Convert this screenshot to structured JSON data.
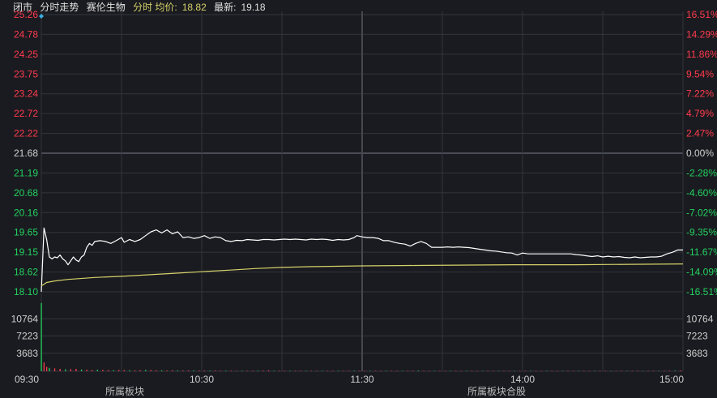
{
  "header": {
    "status": "闭市",
    "mode": "分时走势",
    "stock_name": "赛伦生物",
    "avg_label": "分时 均价:",
    "avg_value": "18.82",
    "latest_label": "最新:",
    "latest_value": "19.18"
  },
  "bottom_fragments": [
    "所属板块",
    "所属板块合股"
  ],
  "colors": {
    "background": "#1a1b20",
    "grid": "#33353b",
    "price_line": "#ffffff",
    "avg_line": "#d6d26a",
    "up": "#ff3b4e",
    "down": "#23d160",
    "neutral": "#d0d0d0",
    "marker": "#3ab0e0"
  },
  "chart_data": {
    "type": "line",
    "prev_close": 21.68,
    "price_axis": {
      "ticks": [
        "25.26",
        "24.78",
        "24.25",
        "23.75",
        "23.24",
        "22.72",
        "22.22",
        "21.68",
        "21.19",
        "20.68",
        "20.16",
        "19.65",
        "19.15",
        "18.62",
        "18.10"
      ],
      "ylim": [
        18.1,
        25.26
      ]
    },
    "pct_axis": {
      "ticks": [
        "16.51%",
        "14.29%",
        "11.86%",
        "9.54%",
        "7.22%",
        "4.79%",
        "2.47%",
        "0.00%",
        "-2.28%",
        "-4.60%",
        "-7.02%",
        "-9.35%",
        "-11.67%",
        "-14.09%",
        "-16.51%"
      ]
    },
    "volume_axis": {
      "ticks": [
        "10764",
        "7223",
        "3683"
      ],
      "ylim": [
        0,
        14300
      ]
    },
    "time_axis": {
      "labels": [
        "09:30",
        "10:30",
        "11:30",
        "14:00",
        "15:00"
      ],
      "minutes_total": 240
    },
    "series": [
      {
        "key": "price",
        "points": [
          [
            0,
            18.1
          ],
          [
            1,
            19.75
          ],
          [
            2,
            19.45
          ],
          [
            3,
            19.0
          ],
          [
            4,
            18.95
          ],
          [
            5,
            19.0
          ],
          [
            6,
            18.98
          ],
          [
            7,
            19.05
          ],
          [
            8,
            18.95
          ],
          [
            9,
            18.9
          ],
          [
            10,
            18.8
          ],
          [
            11,
            18.9
          ],
          [
            12,
            19.0
          ],
          [
            13,
            18.92
          ],
          [
            14,
            18.88
          ],
          [
            15,
            19.0
          ],
          [
            16,
            19.05
          ],
          [
            17,
            19.25
          ],
          [
            18,
            19.35
          ],
          [
            19,
            19.3
          ],
          [
            20,
            19.4
          ],
          [
            22,
            19.42
          ],
          [
            24,
            19.4
          ],
          [
            26,
            19.35
          ],
          [
            28,
            19.42
          ],
          [
            30,
            19.5
          ],
          [
            31,
            19.38
          ],
          [
            33,
            19.45
          ],
          [
            35,
            19.4
          ],
          [
            37,
            19.45
          ],
          [
            39,
            19.55
          ],
          [
            41,
            19.65
          ],
          [
            43,
            19.7
          ],
          [
            45,
            19.62
          ],
          [
            47,
            19.7
          ],
          [
            49,
            19.6
          ],
          [
            51,
            19.65
          ],
          [
            53,
            19.5
          ],
          [
            55,
            19.52
          ],
          [
            57,
            19.48
          ],
          [
            59,
            19.5
          ],
          [
            61,
            19.55
          ],
          [
            63,
            19.48
          ],
          [
            65,
            19.52
          ],
          [
            67,
            19.5
          ],
          [
            69,
            19.42
          ],
          [
            71,
            19.4
          ],
          [
            73,
            19.43
          ],
          [
            75,
            19.42
          ],
          [
            77,
            19.45
          ],
          [
            79,
            19.44
          ],
          [
            81,
            19.43
          ],
          [
            83,
            19.45
          ],
          [
            85,
            19.45
          ],
          [
            87,
            19.44
          ],
          [
            89,
            19.45
          ],
          [
            91,
            19.46
          ],
          [
            93,
            19.45
          ],
          [
            95,
            19.46
          ],
          [
            97,
            19.45
          ],
          [
            99,
            19.44
          ],
          [
            101,
            19.46
          ],
          [
            103,
            19.45
          ],
          [
            105,
            19.46
          ],
          [
            107,
            19.45
          ],
          [
            109,
            19.43
          ],
          [
            111,
            19.45
          ],
          [
            113,
            19.44
          ],
          [
            115,
            19.45
          ],
          [
            117,
            19.5
          ],
          [
            118,
            19.55
          ],
          [
            120,
            19.52
          ],
          [
            122,
            19.5
          ],
          [
            124,
            19.5
          ],
          [
            126,
            19.48
          ],
          [
            128,
            19.42
          ],
          [
            130,
            19.42
          ],
          [
            132,
            19.38
          ],
          [
            134,
            19.35
          ],
          [
            136,
            19.33
          ],
          [
            138,
            19.28
          ],
          [
            140,
            19.35
          ],
          [
            142,
            19.4
          ],
          [
            144,
            19.35
          ],
          [
            146,
            19.25
          ],
          [
            148,
            19.25
          ],
          [
            150,
            19.25
          ],
          [
            152,
            19.26
          ],
          [
            154,
            19.25
          ],
          [
            156,
            19.26
          ],
          [
            158,
            19.25
          ],
          [
            160,
            19.24
          ],
          [
            162,
            19.22
          ],
          [
            164,
            19.2
          ],
          [
            166,
            19.18
          ],
          [
            168,
            19.16
          ],
          [
            170,
            19.15
          ],
          [
            172,
            19.13
          ],
          [
            174,
            19.11
          ],
          [
            176,
            19.1
          ],
          [
            178,
            19.05
          ],
          [
            180,
            19.1
          ],
          [
            182,
            19.08
          ],
          [
            184,
            19.08
          ],
          [
            186,
            19.08
          ],
          [
            188,
            19.08
          ],
          [
            190,
            19.08
          ],
          [
            192,
            19.08
          ],
          [
            194,
            19.08
          ],
          [
            196,
            19.08
          ],
          [
            198,
            19.08
          ],
          [
            200,
            19.06
          ],
          [
            202,
            19.05
          ],
          [
            204,
            19.03
          ],
          [
            206,
            19.01
          ],
          [
            208,
            19.03
          ],
          [
            210,
            19.0
          ],
          [
            212,
            19.02
          ],
          [
            214,
            19.0
          ],
          [
            216,
            19.01
          ],
          [
            218,
            18.99
          ],
          [
            220,
            18.98
          ],
          [
            222,
            19.0
          ],
          [
            224,
            18.98
          ],
          [
            226,
            18.99
          ],
          [
            228,
            19.0
          ],
          [
            230,
            19.0
          ],
          [
            232,
            19.02
          ],
          [
            234,
            19.08
          ],
          [
            236,
            19.12
          ],
          [
            238,
            19.18
          ],
          [
            240,
            19.18
          ]
        ]
      },
      {
        "key": "average",
        "points": [
          [
            0,
            18.25
          ],
          [
            2,
            18.34
          ],
          [
            5,
            18.38
          ],
          [
            10,
            18.42
          ],
          [
            20,
            18.47
          ],
          [
            30,
            18.5
          ],
          [
            40,
            18.54
          ],
          [
            50,
            18.58
          ],
          [
            60,
            18.62
          ],
          [
            70,
            18.66
          ],
          [
            80,
            18.7
          ],
          [
            90,
            18.73
          ],
          [
            100,
            18.75
          ],
          [
            110,
            18.76
          ],
          [
            120,
            18.77
          ],
          [
            140,
            18.78
          ],
          [
            160,
            18.79
          ],
          [
            180,
            18.8
          ],
          [
            200,
            18.8
          ],
          [
            220,
            18.81
          ],
          [
            240,
            18.82
          ]
        ]
      }
    ],
    "volume": [
      [
        0,
        14000
      ],
      [
        1,
        1800
      ],
      [
        2,
        900
      ],
      [
        3,
        700
      ],
      [
        5,
        600
      ],
      [
        7,
        500
      ],
      [
        9,
        400
      ],
      [
        11,
        450
      ],
      [
        13,
        500
      ],
      [
        15,
        350
      ],
      [
        17,
        300
      ],
      [
        19,
        250
      ],
      [
        21,
        300
      ],
      [
        23,
        280
      ],
      [
        25,
        220
      ],
      [
        27,
        200
      ],
      [
        29,
        250
      ],
      [
        31,
        240
      ],
      [
        33,
        200
      ],
      [
        35,
        180
      ],
      [
        37,
        220
      ],
      [
        39,
        260
      ],
      [
        41,
        240
      ],
      [
        43,
        200
      ],
      [
        45,
        180
      ],
      [
        47,
        160
      ],
      [
        49,
        180
      ],
      [
        51,
        150
      ],
      [
        53,
        140
      ],
      [
        55,
        160
      ],
      [
        57,
        150
      ],
      [
        59,
        130
      ],
      [
        61,
        140
      ],
      [
        63,
        120
      ],
      [
        65,
        130
      ],
      [
        67,
        120
      ],
      [
        69,
        110
      ],
      [
        71,
        120
      ],
      [
        73,
        100
      ],
      [
        75,
        110
      ],
      [
        77,
        100
      ],
      [
        79,
        120
      ],
      [
        81,
        110
      ],
      [
        83,
        140
      ],
      [
        85,
        180
      ],
      [
        87,
        120
      ],
      [
        89,
        110
      ],
      [
        91,
        100
      ],
      [
        93,
        110
      ],
      [
        95,
        100
      ],
      [
        97,
        110
      ],
      [
        99,
        100
      ],
      [
        101,
        90
      ],
      [
        103,
        100
      ],
      [
        105,
        95
      ],
      [
        107,
        90
      ],
      [
        109,
        100
      ],
      [
        111,
        95
      ],
      [
        113,
        90
      ],
      [
        115,
        100
      ],
      [
        117,
        120
      ],
      [
        119,
        100
      ],
      [
        121,
        110
      ],
      [
        123,
        95
      ],
      [
        125,
        100
      ],
      [
        127,
        95
      ],
      [
        129,
        90
      ],
      [
        131,
        100
      ],
      [
        133,
        95
      ],
      [
        135,
        90
      ],
      [
        137,
        100
      ],
      [
        139,
        110
      ],
      [
        141,
        120
      ],
      [
        143,
        100
      ],
      [
        145,
        95
      ],
      [
        147,
        90
      ],
      [
        149,
        85
      ],
      [
        151,
        90
      ],
      [
        153,
        85
      ],
      [
        155,
        90
      ],
      [
        157,
        85
      ],
      [
        159,
        80
      ],
      [
        161,
        90
      ],
      [
        163,
        85
      ],
      [
        165,
        80
      ],
      [
        167,
        85
      ],
      [
        169,
        90
      ],
      [
        171,
        85
      ],
      [
        173,
        80
      ],
      [
        175,
        90
      ],
      [
        177,
        85
      ],
      [
        179,
        80
      ],
      [
        181,
        85
      ],
      [
        183,
        90
      ],
      [
        185,
        85
      ],
      [
        187,
        80
      ],
      [
        189,
        85
      ],
      [
        191,
        90
      ],
      [
        193,
        80
      ],
      [
        195,
        85
      ],
      [
        197,
        90
      ],
      [
        199,
        85
      ],
      [
        201,
        80
      ],
      [
        203,
        85
      ],
      [
        205,
        80
      ],
      [
        207,
        85
      ],
      [
        209,
        80
      ],
      [
        211,
        85
      ],
      [
        213,
        80
      ],
      [
        215,
        85
      ],
      [
        217,
        80
      ],
      [
        219,
        85
      ],
      [
        221,
        90
      ],
      [
        223,
        80
      ],
      [
        225,
        85
      ],
      [
        227,
        80
      ],
      [
        229,
        90
      ],
      [
        231,
        85
      ],
      [
        233,
        100
      ],
      [
        235,
        110
      ],
      [
        237,
        120
      ],
      [
        239,
        150
      ]
    ]
  }
}
